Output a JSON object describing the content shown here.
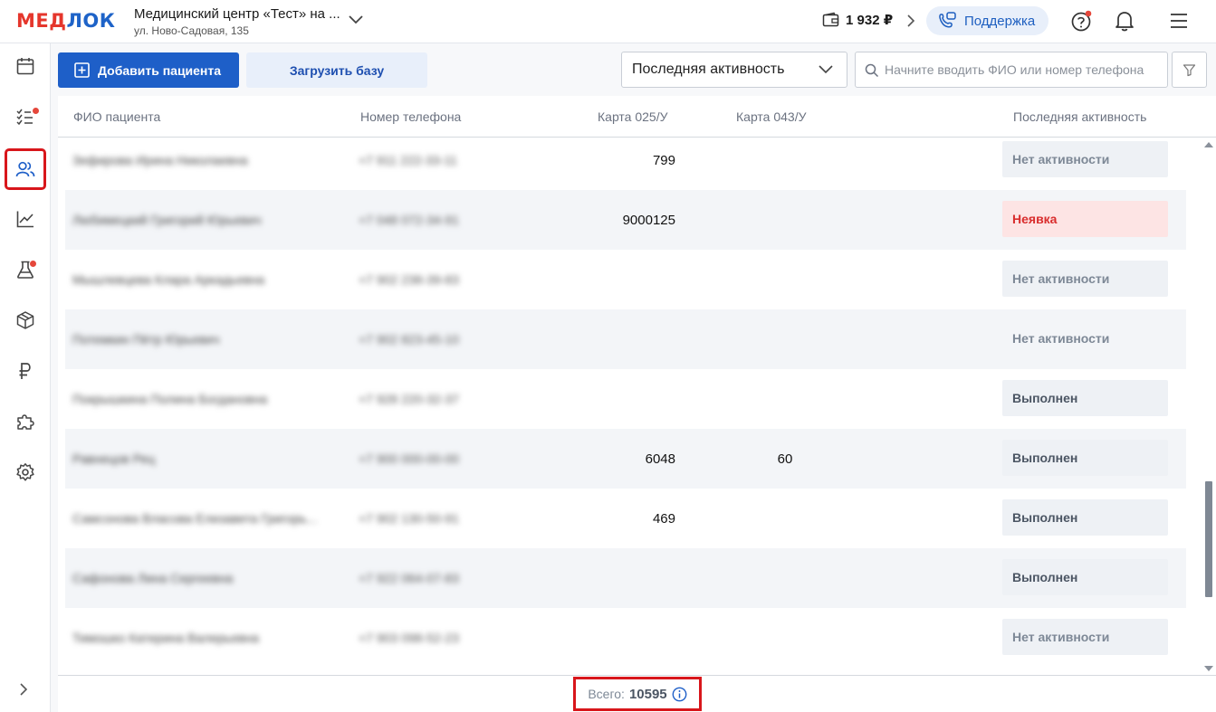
{
  "header": {
    "logo_main": "МЕД",
    "logo_rest": "ЛОК",
    "clinic_name": "Медицинский центр «Тест» на ...",
    "clinic_address": "ул. Ново-Садовая, 135",
    "balance": "1 932 ₽",
    "support_label": "Поддержка"
  },
  "toolbar": {
    "add_patient": "Добавить пациента",
    "upload_base": "Загрузить базу",
    "sort_select": "Последняя активность",
    "search_placeholder": "Начните вводить ФИО или номер телефона"
  },
  "table": {
    "columns": [
      "ФИО пациента",
      "Номер телефона",
      "Карта 025/У",
      "Карта 043/У",
      "Последняя активность"
    ],
    "rows": [
      {
        "name": "Зефирова Ирина Николаевна",
        "phone": "+7 911 222-33-11",
        "card025": "799",
        "card043": "",
        "status": "Нет активности",
        "kind": "none"
      },
      {
        "name": "Любимецкий Григорий Юрьевич",
        "phone": "+7 048 072-34-91",
        "card025": "9000125",
        "card043": "",
        "status": "Неявка",
        "kind": "miss"
      },
      {
        "name": "Мышлевцева Клара Аркадьевна",
        "phone": "+7 902 238-39-83",
        "card025": "",
        "card043": "",
        "status": "Нет активности",
        "kind": "none"
      },
      {
        "name": "Потемкин Пётр Юрьевич",
        "phone": "+7 902 823-45-10",
        "card025": "",
        "card043": "",
        "status": "Нет активности",
        "kind": "none"
      },
      {
        "name": "Покрышкина Полина Богдановна",
        "phone": "+7 928 220-32-37",
        "card025": "",
        "card043": "",
        "status": "Выполнен",
        "kind": "done"
      },
      {
        "name": "Равнецов Рец",
        "phone": "+7 900 000-00-00",
        "card025": "6048",
        "card043": "60",
        "status": "Выполнен",
        "kind": "done"
      },
      {
        "name": "Самсонова Власова Елизавета Григорь...",
        "phone": "+7 902 130-50-91",
        "card025": "469",
        "card043": "",
        "status": "Выполнен",
        "kind": "done"
      },
      {
        "name": "Сафонова Лина Сергеевна",
        "phone": "+7 922 064-07-83",
        "card025": "",
        "card043": "",
        "status": "Выполнен",
        "kind": "done"
      },
      {
        "name": "Тимошко Катерина Валерьевна",
        "phone": "+7 903 098-52-23",
        "card025": "",
        "card043": "",
        "status": "Нет активности",
        "kind": "none"
      }
    ]
  },
  "footer": {
    "total_label": "Всего:",
    "total_value": "10595"
  },
  "colors": {
    "primary": "#1e5fc8",
    "highlight_outline": "#d8161b",
    "miss_badge_bg": "#fde4e4",
    "miss_badge_text": "#d92d2d"
  }
}
